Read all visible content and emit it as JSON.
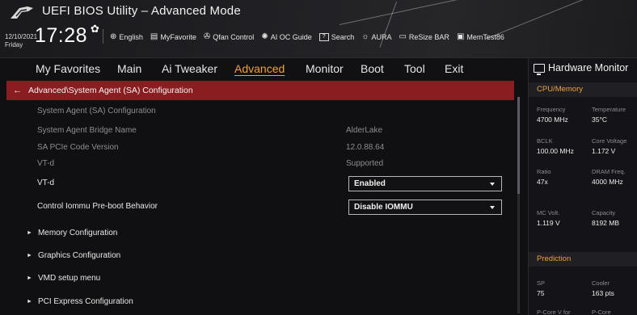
{
  "header": {
    "title": "UEFI BIOS Utility – Advanced Mode",
    "date_line1": "12/10/2021",
    "date_line2": "Friday",
    "time": "17:28",
    "gear_glyph": "✿",
    "tools": [
      {
        "icon": "globe-icon",
        "glyph": "⊕",
        "label": "English"
      },
      {
        "icon": "myfavorite-icon",
        "glyph": "▤",
        "label": "MyFavorite"
      },
      {
        "icon": "fan-icon",
        "glyph": "✇",
        "label": "Qfan Control"
      },
      {
        "icon": "ai-oc-icon",
        "glyph": "✺",
        "label": "AI OC Guide"
      },
      {
        "icon": "search-icon",
        "glyph": "?",
        "label": "Search"
      },
      {
        "icon": "aura-icon",
        "glyph": "☼",
        "label": "AURA"
      },
      {
        "icon": "resizebar-icon",
        "glyph": "▭",
        "label": "ReSize BAR"
      },
      {
        "icon": "memtest-icon",
        "glyph": "▣",
        "label": "MemTest86"
      }
    ]
  },
  "nav": {
    "items": [
      "My Favorites",
      "Main",
      "Ai Tweaker",
      "Advanced",
      "Monitor",
      "Boot",
      "Tool",
      "Exit"
    ],
    "active": "Advanced"
  },
  "main": {
    "breadcrumb": "Advanced\\System Agent (SA) Configuration",
    "info_rows": [
      {
        "label": "System Agent (SA) Configuration",
        "value": ""
      },
      {
        "label": "System Agent Bridge Name",
        "value": "AlderLake"
      },
      {
        "label": "SA PCIe Code Version",
        "value": "12.0.88.64"
      },
      {
        "label": "VT-d",
        "value": "Supported"
      }
    ],
    "settings": [
      {
        "label": "VT-d",
        "value": "Enabled"
      },
      {
        "label": "Control Iommu Pre-boot Behavior",
        "value": "Disable IOMMU"
      }
    ],
    "submenus": [
      "Memory Configuration",
      "Graphics Configuration",
      "VMD setup menu",
      "PCI Express Configuration"
    ]
  },
  "monitor": {
    "title": "Hardware Monitor",
    "sections": [
      {
        "name": "CPU/Memory",
        "items": [
          {
            "label": "Frequency",
            "value": "4700 MHz"
          },
          {
            "label": "Temperature",
            "value": "35°C"
          },
          {
            "label": "BCLK",
            "value": "100.00 MHz"
          },
          {
            "label": "Core Voltage",
            "value": "1.172 V"
          },
          {
            "label": "Ratio",
            "value": "47x"
          },
          {
            "label": "DRAM Freq.",
            "value": "4000 MHz"
          },
          {
            "label": "MC Volt.",
            "value": "1.119 V"
          },
          {
            "label": "Capacity",
            "value": "8192 MB"
          }
        ]
      },
      {
        "name": "Prediction",
        "items": [
          {
            "label": "SP",
            "value": "75"
          },
          {
            "label": "Cooler",
            "value": "163 pts"
          },
          {
            "label": "P-Core V for",
            "value": ""
          },
          {
            "label": "P-Core",
            "value": ""
          }
        ]
      }
    ]
  },
  "colors": {
    "accent": "#f0a23a",
    "breadcrumb_bg": "#8a1d1f",
    "background": "#101012"
  }
}
